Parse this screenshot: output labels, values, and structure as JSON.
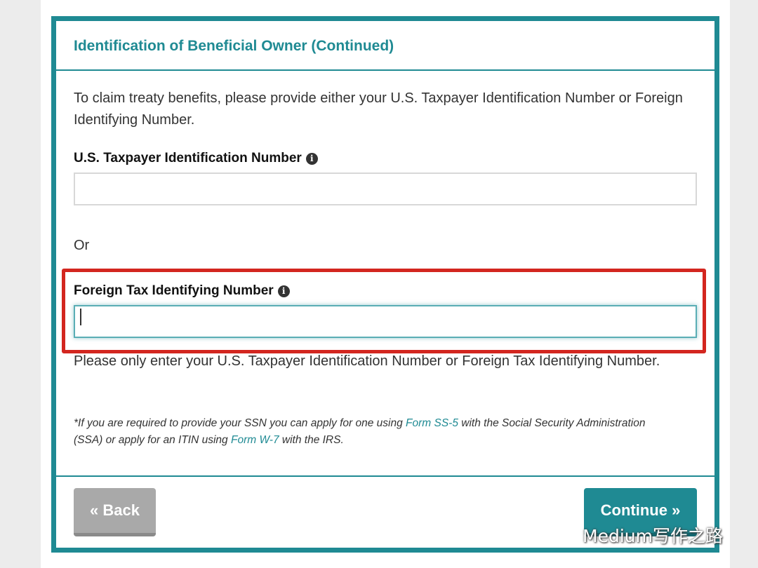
{
  "card": {
    "title": "Identification of Beneficial Owner (Continued)",
    "intro": "To claim treaty benefits, please provide either your U.S. Taxpayer Identification Number or Foreign Identifying Number."
  },
  "fields": {
    "us_tin_label": "U.S. Taxpayer Identification Number",
    "us_tin_value": "",
    "or_text": "Or",
    "foreign_tin_label": "Foreign Tax Identifying Number",
    "foreign_tin_value": ""
  },
  "note": "Please only enter your U.S. Taxpayer Identification Number or Foreign Tax Identifying Number.",
  "footnote": {
    "part1": "*If you are required to provide your SSN you can apply for one using ",
    "link1": "Form SS-5",
    "part2": " with the Social Security Administration (SSA) or apply for an ITIN using ",
    "link2": "Form W-7",
    "part3": " with the IRS."
  },
  "buttons": {
    "back_label": "« Back",
    "continue_label": "Continue »"
  },
  "watermark": {
    "text": "Medium写作之路"
  },
  "colors": {
    "accent": "#1f8a93",
    "highlight": "#d3261f",
    "back_button": "#a9a9a9"
  },
  "icons": {
    "info": "info-circle-icon"
  }
}
